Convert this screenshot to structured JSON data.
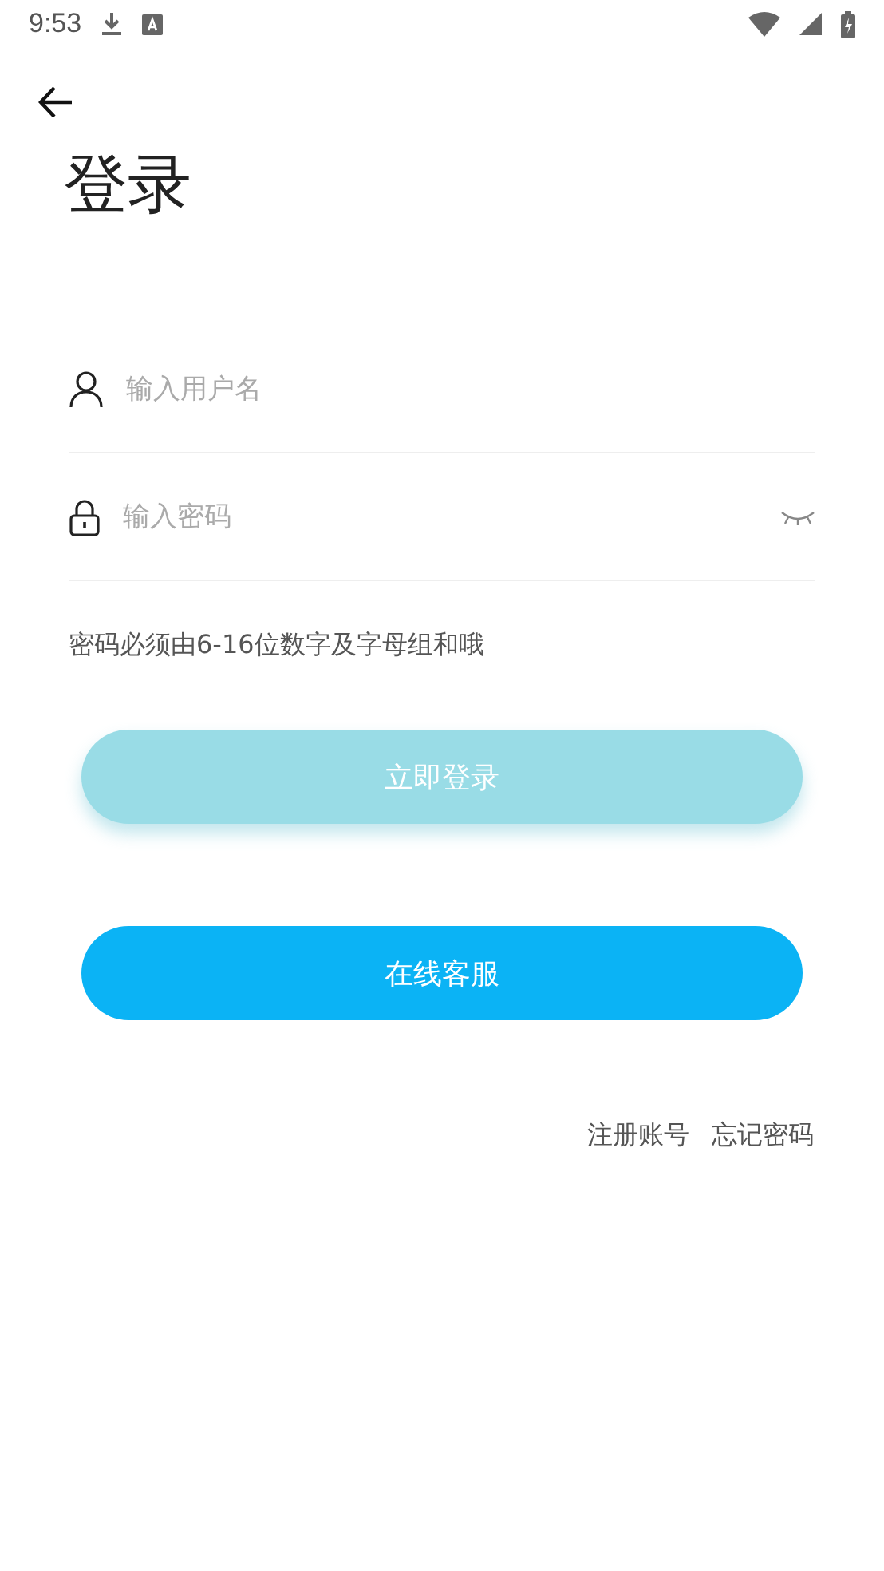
{
  "status_bar": {
    "time": "9:53"
  },
  "title": "登录",
  "fields": [
    {
      "kind": "user",
      "placeholder": "输入用户名"
    },
    {
      "kind": "password",
      "placeholder": "输入密码",
      "revealed": false
    }
  ],
  "hint": "密码必须由6-16位数字及字母组和哦",
  "buttons": [
    {
      "label": "立即登录",
      "disabled": true
    },
    {
      "label": "在线客服",
      "disabled": false
    }
  ],
  "links": [
    "注册账号",
    "忘记密码"
  ]
}
